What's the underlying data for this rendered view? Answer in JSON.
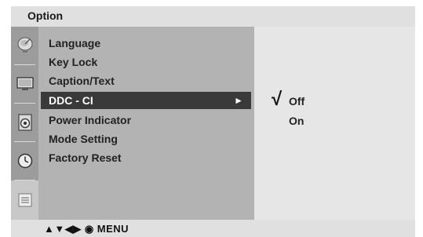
{
  "menu_title": "Option",
  "sidebar": {
    "icons": [
      "satellite-dish-icon",
      "tv-screen-icon",
      "speaker-icon",
      "clock-icon",
      "option-panel-icon"
    ],
    "active_index": 4
  },
  "menu": {
    "items": [
      {
        "label": "Language"
      },
      {
        "label": "Key Lock"
      },
      {
        "label": "Caption/Text"
      },
      {
        "label": "DDC - CI",
        "selected": true,
        "arrow": "►"
      },
      {
        "label": "Power Indicator"
      },
      {
        "label": "Mode Setting"
      },
      {
        "label": "Factory Reset"
      }
    ]
  },
  "submenu": {
    "options": [
      {
        "label": "Off",
        "checked": true
      },
      {
        "label": "On",
        "checked": false
      }
    ],
    "check_mark": "√"
  },
  "footer": {
    "hint": "▲▼◀▶ ◉ MENU"
  },
  "colors": {
    "selected_bg": "#3a3a3a",
    "menu_bg": "#b3b3b3",
    "sub_bg": "#e6e6e6"
  }
}
